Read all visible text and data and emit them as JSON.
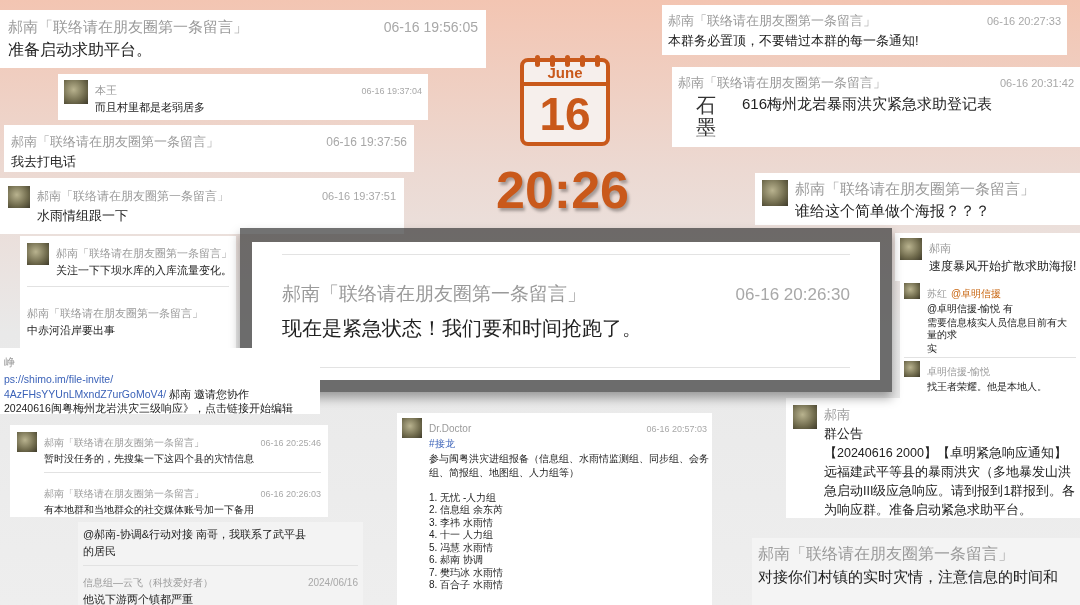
{
  "calendar": {
    "month": "June",
    "day": "16"
  },
  "clock": "20:26",
  "cards": [
    {
      "messages": [
        {
          "name": "郝南「联络请在朋友圈第一条留言」",
          "time": "06-16 19:56:05",
          "lines": [
            "准备启动求助平台。"
          ]
        }
      ]
    },
    {
      "messages": [
        {
          "avatar": true,
          "name": "本王",
          "time": "06-16 19:37:04",
          "lines": [
            "而且村里都是老弱居多"
          ]
        }
      ]
    },
    {
      "messages": [
        {
          "name": "郝南「联络请在朋友圈第一条留言」",
          "time": "06-16 19:37:56",
          "lines": [
            "我去打电话"
          ]
        }
      ]
    },
    {
      "messages": [
        {
          "avatar": true,
          "name": "郝南「联络请在朋友圈第一条留言」",
          "time": "06-16 19:37:51",
          "lines": [
            "水雨情组跟一下"
          ]
        }
      ]
    },
    {
      "messages": [
        {
          "avatar": true,
          "name": "郝南「联络请在朋友圈第一条留言」",
          "lines": [
            "关注一下下坝水库的入库流量变化。"
          ]
        },
        {
          "name": "郝南「联络请在朋友圈第一条留言」",
          "lines": [
            "中赤河沿岸要出事"
          ]
        }
      ]
    },
    {
      "messages": [
        {
          "name": "峥",
          "link_lines": [
            "ps://shimo.im/file-invite/",
            "4AzFHsYYUnLMxndZ7urGoMoV4/"
          ],
          "link_inline": true,
          "lines": [
            "郝南 邀请您协作",
            "20240616闽粤梅州龙岩洪灾三级响应》，点击链接开始编辑"
          ]
        }
      ]
    },
    {
      "messages": [
        {
          "name": "郝南「联络请在朋友圈第一条留言」",
          "time": "06-16 20:27:33",
          "lines": [
            "本群务必置顶，不要错过本群的每一条通知!"
          ]
        }
      ]
    },
    {
      "messages": [
        {
          "logo_text": "石墨",
          "name": "郝南「联络请在朋友圈第一条留言」",
          "time": "06-16 20:31:42",
          "lines": [
            "616梅州龙岩暴雨洪灾紧急求助登记表"
          ]
        }
      ]
    },
    {
      "messages": [
        {
          "avatar": true,
          "name": "郝南「联络请在朋友圈第一条留言」",
          "lines": [
            "谁给这个简单做个海报？？？"
          ]
        }
      ]
    },
    {
      "messages": [
        {
          "avatar": true,
          "name": "郝南",
          "lines": [
            "速度暴风开始扩散求助海报!"
          ]
        }
      ]
    },
    {
      "messages": [
        {
          "avatar": true,
          "name": "苏红",
          "mention": "@卓明信援",
          "lines": [
            "@卓明信援-愉悦 有",
            "需要信息核实人员信息目前有大量的求",
            "实"
          ]
        },
        {
          "avatar": true,
          "name": "卓明信援-愉悦",
          "lines": [
            "找王者荣耀。他是本地人。"
          ]
        }
      ]
    },
    {
      "messages": [
        {
          "avatar": true,
          "name": "郝南「联络请在朋友圈第一条留言」",
          "time": "06-16 20:25:46",
          "lines": [
            "暂时没任务的，先搜集一下这四个县的灾情信息"
          ]
        },
        {
          "name": "郝南「联络请在朋友圈第一条留言」",
          "time": "06-16 20:26:03",
          "lines": [
            "有本地群和当地群众的社交媒体账号加一下备用"
          ]
        }
      ]
    },
    {
      "messages": [
        {
          "lines": [
            "@郝南-协调&行动对接 南哥，我联系了武平县",
            "的居民"
          ]
        },
        {
          "name": "信息组—云飞（科技爱好者）",
          "time": "2024/06/16",
          "lines": [
            "他说下游两个镇都严重"
          ]
        }
      ]
    },
    {
      "messages": [
        {
          "avatar": true,
          "name": "Dr.Doctor",
          "time": "06-16 20:57:03",
          "link_lines": [
            "#接龙"
          ],
          "link_inline": false,
          "lines": [
            "参与闽粤洪灾进组报备（信息组、水雨情监测组、同步组、会务",
            "组、简报组、地图组、人力组等）"
          ],
          "list": [
            "1. 无忧 -人力组",
            "2. 信息组 余东芮",
            "3. 李祎 水雨情",
            "4. 十一 人力组",
            "5. 冯慧 水雨情",
            "6. 郝南 协调",
            "7. 樊玙冰 水雨情",
            "8. 百合子 水雨情"
          ]
        }
      ]
    },
    {
      "messages": [
        {
          "avatar": true,
          "name": "郝南",
          "lines": [
            "群公告",
            "【20240616 2000】【卓明紧急响应通知】",
            "远福建武平等县的暴雨洪灾（多地暴发山洪",
            "急启动III级应急响应。请到报到1群报到。各",
            "为响应群。准备启动紧急求助平台。"
          ]
        }
      ]
    },
    {
      "messages": [
        {
          "name": "郝南「联络请在朋友圈第一条留言」",
          "lines": [
            "对接你们村镇的实时灾情，注意信息的时间和"
          ]
        }
      ]
    }
  ],
  "focus": {
    "name": "郝南「联络请在朋友圈第一条留言」",
    "time": "06-16 20:26:30",
    "text": "现在是紧急状态！我们要和时间抢跑了。"
  }
}
